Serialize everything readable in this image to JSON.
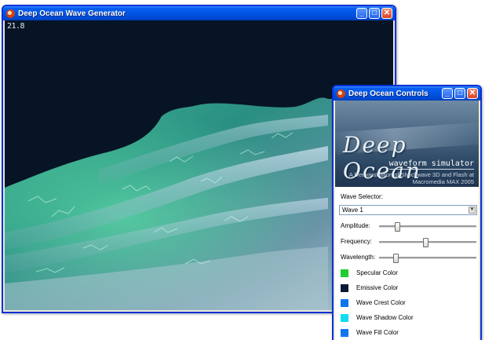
{
  "main_window": {
    "title": "Deep Ocean Wave Generator",
    "fps": "21.8"
  },
  "controls_window": {
    "title": "Deep Ocean Controls",
    "banner": {
      "logo": "Deep Ocean",
      "subtitle": "waveform simulator",
      "credit_line1": "A Demonstration of Shockwave 3D and Flash at",
      "credit_line2": "Macromedia MAX 2005"
    },
    "wave_selector": {
      "label": "Wave Selector:",
      "selected": "Wave 1"
    },
    "sliders": [
      {
        "label": "Amplitude:",
        "value": 0.18
      },
      {
        "label": "Frequency:",
        "value": 0.47
      },
      {
        "label": "Wavelength:",
        "value": 0.16
      }
    ],
    "colors": [
      {
        "label": "Specular Color",
        "hex": "#22cc33"
      },
      {
        "label": "Emissive Color",
        "hex": "#0a1a33"
      },
      {
        "label": "Wave Crest Color",
        "hex": "#1177ee"
      },
      {
        "label": "Wave Shadow Color",
        "hex": "#11ddee"
      },
      {
        "label": "Wave Fill Color",
        "hex": "#1177ee"
      }
    ]
  },
  "icons": {
    "window_icon": "deep-ocean-app-icon",
    "minimize": "minimize-icon",
    "maximize": "maximize-icon",
    "close": "close-icon",
    "dropdown": "chevron-down-icon"
  }
}
